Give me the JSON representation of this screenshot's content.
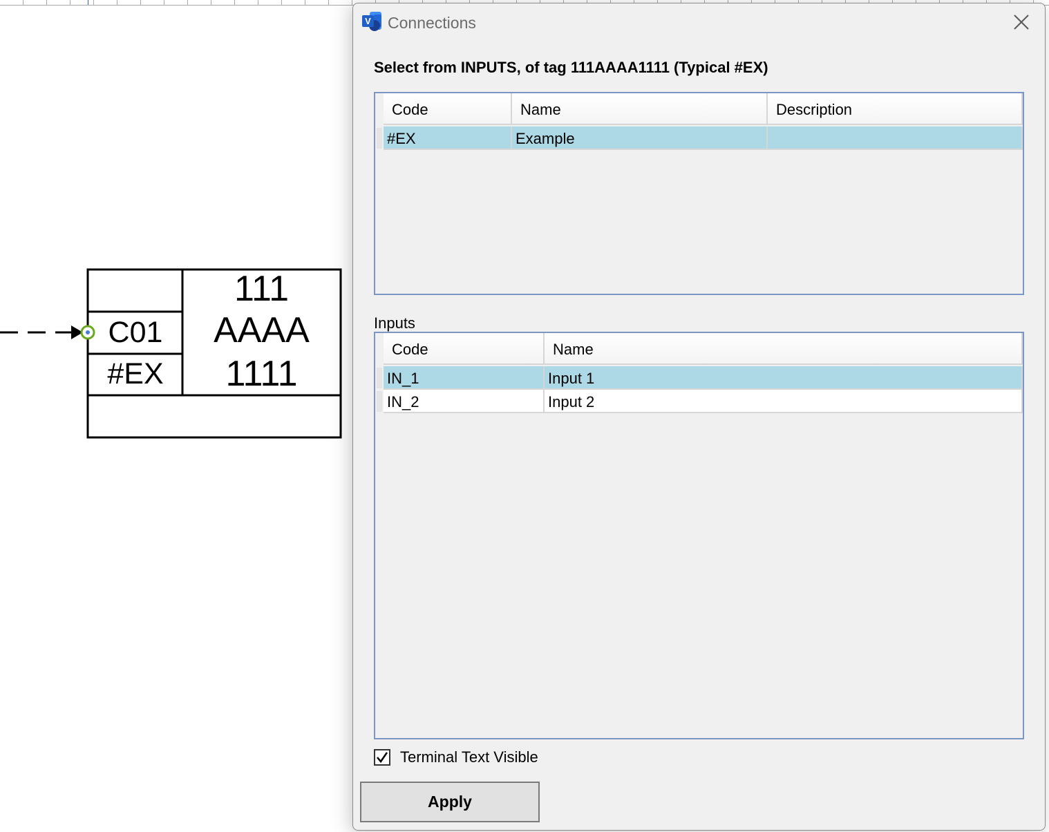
{
  "canvas": {
    "shape": {
      "top_cell": "",
      "terminal_code": "C01",
      "typical_code": "#EX",
      "tag_line1": "111",
      "tag_line2": "AAAA",
      "tag_line3": "1111",
      "bottom_cell": ""
    }
  },
  "dialog": {
    "title": "Connections",
    "app_icon": "visio-icon",
    "close_icon": "close-icon",
    "heading": "Select from INPUTS, of tag 111AAAA1111 (Typical #EX)",
    "typicals_table": {
      "columns": [
        "Code",
        "Name",
        "Description"
      ],
      "rows": [
        {
          "code": "#EX",
          "name": "Example",
          "description": "",
          "selected": true
        }
      ]
    },
    "inputs_label": "Inputs",
    "inputs_table": {
      "columns": [
        "Code",
        "Name"
      ],
      "rows": [
        {
          "code": "IN_1",
          "name": "Input 1",
          "selected": true
        },
        {
          "code": "IN_2",
          "name": "Input 2",
          "selected": false
        }
      ]
    },
    "terminal_text_visible": {
      "label": "Terminal Text Visible",
      "checked": true
    },
    "apply_label": "Apply"
  },
  "colors": {
    "selection": "#add8e6",
    "grid_border": "#7b95c4",
    "connection_point": "#6aa820",
    "dialog_background": "#f0f0f0"
  }
}
